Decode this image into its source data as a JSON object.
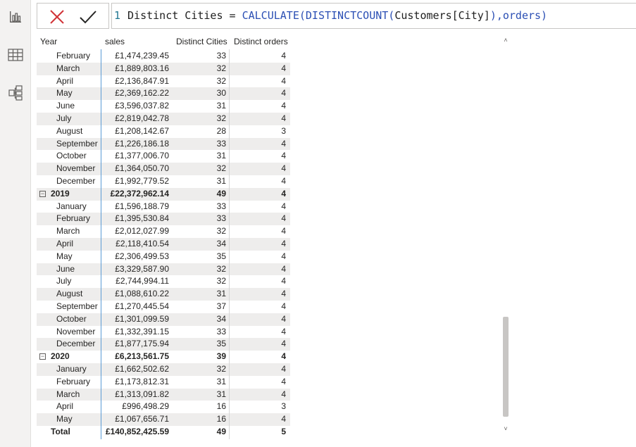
{
  "formula": {
    "line_number": "1",
    "measure_name": "Distinct Cities",
    "equals": " = ",
    "function": "CALCULATE(DISTINCTCOUNT(",
    "column_ref": "Customers[City]",
    "tail": "),orders)"
  },
  "headers": {
    "year": "Year",
    "sales": "sales",
    "cities": "Distinct Cities",
    "orders": "Distinct orders"
  },
  "rows": [
    {
      "label": "February",
      "sales": "£1,474,239.45",
      "cities": "33",
      "orders": "4",
      "level": "month"
    },
    {
      "label": "March",
      "sales": "£1,889,803.16",
      "cities": "32",
      "orders": "4",
      "level": "month"
    },
    {
      "label": "April",
      "sales": "£2,136,847.91",
      "cities": "32",
      "orders": "4",
      "level": "month"
    },
    {
      "label": "May",
      "sales": "£2,369,162.22",
      "cities": "30",
      "orders": "4",
      "level": "month"
    },
    {
      "label": "June",
      "sales": "£3,596,037.82",
      "cities": "31",
      "orders": "4",
      "level": "month"
    },
    {
      "label": "July",
      "sales": "£2,819,042.78",
      "cities": "32",
      "orders": "4",
      "level": "month"
    },
    {
      "label": "August",
      "sales": "£1,208,142.67",
      "cities": "28",
      "orders": "3",
      "level": "month"
    },
    {
      "label": "September",
      "sales": "£1,226,186.18",
      "cities": "33",
      "orders": "4",
      "level": "month"
    },
    {
      "label": "October",
      "sales": "£1,377,006.70",
      "cities": "31",
      "orders": "4",
      "level": "month"
    },
    {
      "label": "November",
      "sales": "£1,364,050.70",
      "cities": "32",
      "orders": "4",
      "level": "month"
    },
    {
      "label": "December",
      "sales": "£1,992,779.52",
      "cities": "31",
      "orders": "4",
      "level": "month"
    },
    {
      "label": "2019",
      "sales": "£22,372,962.14",
      "cities": "49",
      "orders": "4",
      "level": "year"
    },
    {
      "label": "January",
      "sales": "£1,596,188.79",
      "cities": "33",
      "orders": "4",
      "level": "month"
    },
    {
      "label": "February",
      "sales": "£1,395,530.84",
      "cities": "33",
      "orders": "4",
      "level": "month"
    },
    {
      "label": "March",
      "sales": "£2,012,027.99",
      "cities": "32",
      "orders": "4",
      "level": "month"
    },
    {
      "label": "April",
      "sales": "£2,118,410.54",
      "cities": "34",
      "orders": "4",
      "level": "month"
    },
    {
      "label": "May",
      "sales": "£2,306,499.53",
      "cities": "35",
      "orders": "4",
      "level": "month"
    },
    {
      "label": "June",
      "sales": "£3,329,587.90",
      "cities": "32",
      "orders": "4",
      "level": "month"
    },
    {
      "label": "July",
      "sales": "£2,744,994.11",
      "cities": "32",
      "orders": "4",
      "level": "month"
    },
    {
      "label": "August",
      "sales": "£1,088,610.22",
      "cities": "31",
      "orders": "4",
      "level": "month"
    },
    {
      "label": "September",
      "sales": "£1,270,445.54",
      "cities": "37",
      "orders": "4",
      "level": "month"
    },
    {
      "label": "October",
      "sales": "£1,301,099.59",
      "cities": "34",
      "orders": "4",
      "level": "month"
    },
    {
      "label": "November",
      "sales": "£1,332,391.15",
      "cities": "33",
      "orders": "4",
      "level": "month"
    },
    {
      "label": "December",
      "sales": "£1,877,175.94",
      "cities": "35",
      "orders": "4",
      "level": "month"
    },
    {
      "label": "2020",
      "sales": "£6,213,561.75",
      "cities": "39",
      "orders": "4",
      "level": "year"
    },
    {
      "label": "January",
      "sales": "£1,662,502.62",
      "cities": "32",
      "orders": "4",
      "level": "month"
    },
    {
      "label": "February",
      "sales": "£1,173,812.31",
      "cities": "31",
      "orders": "4",
      "level": "month"
    },
    {
      "label": "March",
      "sales": "£1,313,091.82",
      "cities": "31",
      "orders": "4",
      "level": "month"
    },
    {
      "label": "April",
      "sales": "£996,498.29",
      "cities": "16",
      "orders": "3",
      "level": "month"
    },
    {
      "label": "May",
      "sales": "£1,067,656.71",
      "cities": "16",
      "orders": "4",
      "level": "month"
    },
    {
      "label": "Total",
      "sales": "£140,852,425.59",
      "cities": "49",
      "orders": "5",
      "level": "total"
    }
  ],
  "icons": {
    "collapse": "⊟",
    "scroll_up": "˄",
    "scroll_down": "˅"
  },
  "colors": {
    "accent_line": "#5b9bd5",
    "alt_row": "#eeedec",
    "cancel": "#d13438",
    "function_text": "#2b4fb4"
  }
}
